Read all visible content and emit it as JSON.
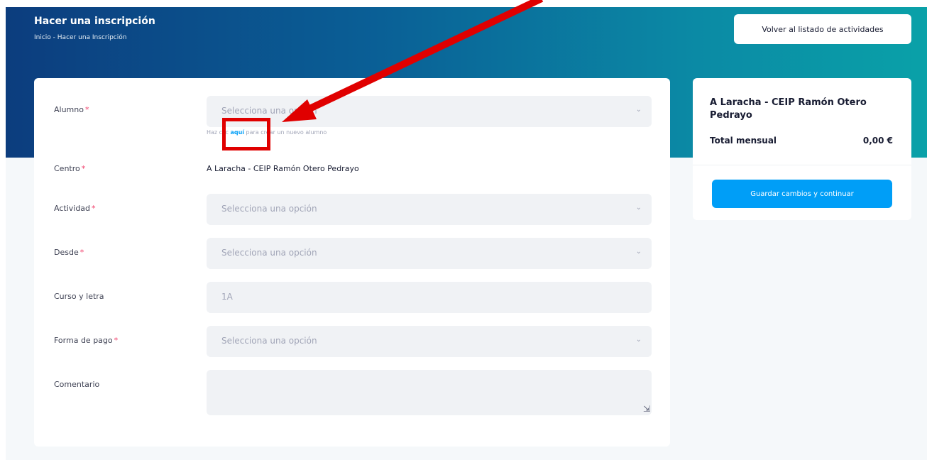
{
  "header": {
    "title": "Hacer una inscripción",
    "breadcrumb": "Inicio - Hacer una Inscripción",
    "back_button": "Volver al listado de actividades"
  },
  "form": {
    "alumno": {
      "label": "Alumno",
      "placeholder": "Selecciona una opción"
    },
    "hint": {
      "before": "Haz clic ",
      "link": "aquí",
      "after": " para crear un nuevo alumno"
    },
    "centro": {
      "label": "Centro",
      "value": "A Laracha - CEIP Ramón Otero Pedrayo"
    },
    "actividad": {
      "label": "Actividad",
      "placeholder": "Selecciona una opción"
    },
    "desde": {
      "label": "Desde",
      "placeholder": "Selecciona una opción"
    },
    "curso": {
      "label": "Curso y letra",
      "placeholder": "1A"
    },
    "forma_pago": {
      "label": "Forma de pago",
      "placeholder": "Selecciona una opción"
    },
    "comentario": {
      "label": "Comentario",
      "value": ""
    },
    "required_mark": "*"
  },
  "summary": {
    "title": "A Laracha - CEIP Ramón Otero Pedrayo",
    "total_label": "Total mensual",
    "total_value": "0,00 €",
    "save_button": "Guardar cambios y continuar"
  },
  "colors": {
    "accent": "#009ef7",
    "required": "#f1416c",
    "annotation": "#e00000"
  }
}
